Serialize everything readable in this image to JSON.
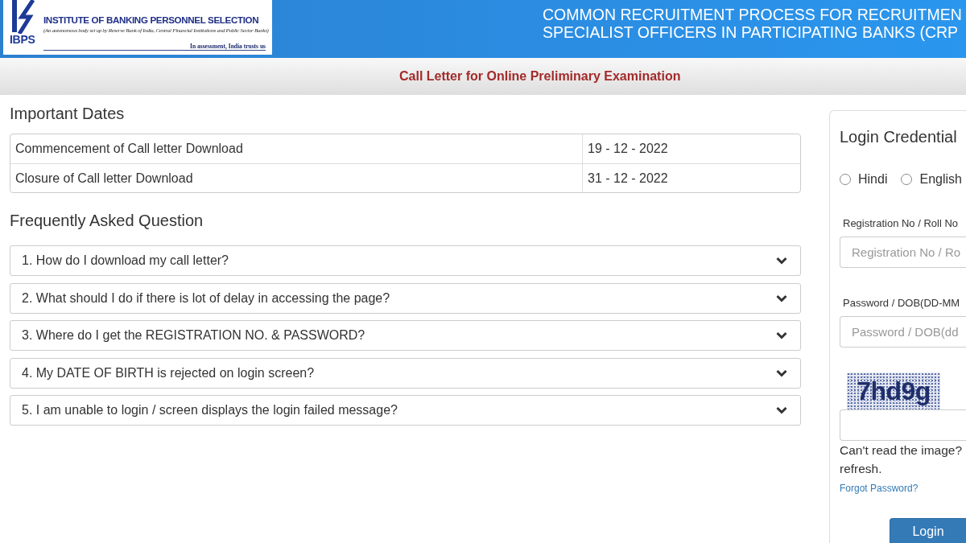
{
  "header": {
    "logo": {
      "acronym": "IBPS",
      "name": "INSTITUTE OF BANKING PERSONNEL SELECTION",
      "subtitle": "(An autonomous body set up by Reserve Bank of India, Central Financial Institutions and Public Sector Banks)",
      "tagline": "In assessment, India trusts us"
    },
    "title_lines": [
      "COMMON RECRUITMENT PROCESS FOR RECRUITMEN",
      "SPECIALIST OFFICERS IN PARTICIPATING BANKS (CRP"
    ]
  },
  "page_title": "Call Letter for Online Preliminary Examination",
  "important_dates": {
    "heading": "Important Dates",
    "rows": [
      {
        "event": "Commencement of Call letter Download",
        "date": "19 - 12 - 2022"
      },
      {
        "event": "Closure of Call letter Download",
        "date": "31 - 12 - 2022"
      }
    ]
  },
  "faq": {
    "heading": "Frequently Asked Question",
    "items": [
      {
        "question": "1. How do I download my call letter?",
        "expanded": false
      },
      {
        "question": "2. What should I do if there is lot of delay in accessing the page?",
        "expanded": false
      },
      {
        "question": "3. Where do I get the REGISTRATION NO. & PASSWORD?",
        "expanded": false
      },
      {
        "question": "4. My DATE OF BIRTH is rejected on login screen?",
        "expanded": false
      },
      {
        "question": "5. I am unable to login / screen displays the login failed message?",
        "expanded": false
      }
    ]
  },
  "login": {
    "heading": "Login Credential",
    "languages": [
      {
        "label": "Hindi",
        "selected": false
      },
      {
        "label": "English",
        "selected": false
      }
    ],
    "fields": [
      {
        "label": "Registration No / Roll No",
        "placeholder": "Registration No / Ro"
      },
      {
        "label": "Password / DOB(DD-MM",
        "placeholder": "Password / DOB(dd"
      }
    ],
    "captcha": {
      "code": "7hd9g"
    },
    "captcha_help_lines": [
      "Can't read the image?",
      "refresh."
    ],
    "forgot_link": "Forgot Password?",
    "submit": "Login"
  }
}
